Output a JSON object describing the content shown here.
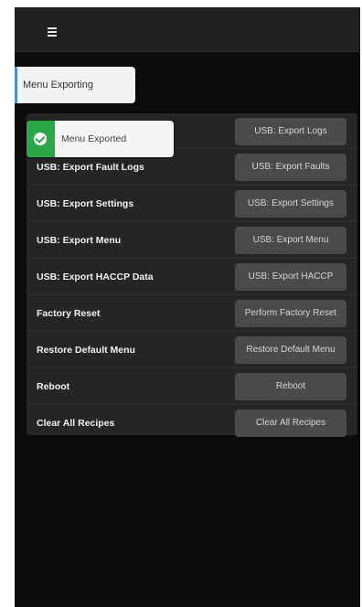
{
  "header": {
    "menu_icon": "hamburger-icon"
  },
  "section_tab": {
    "label": "Menu Exporting"
  },
  "toast": {
    "text": "Menu Exported",
    "icon": "check-circle-icon",
    "accent": "#2aa847"
  },
  "rows": [
    {
      "label": "USB: Export Logs",
      "button": "USB: Export Logs"
    },
    {
      "label": "USB: Export Fault Logs",
      "button": "USB: Export Faults"
    },
    {
      "label": "USB: Export Settings",
      "button": "USB: Export Settings"
    },
    {
      "label": "USB: Export Menu",
      "button": "USB: Export Menu"
    },
    {
      "label": "USB: Export HACCP Data",
      "button": "USB: Export HACCP"
    },
    {
      "label": "Factory Reset",
      "button": "Perform Factory Reset"
    },
    {
      "label": "Restore Default Menu",
      "button": "Restore Default Menu"
    },
    {
      "label": "Reboot",
      "button": "Reboot"
    },
    {
      "label": "Clear All Recipes",
      "button": "Clear All Recipes"
    }
  ]
}
